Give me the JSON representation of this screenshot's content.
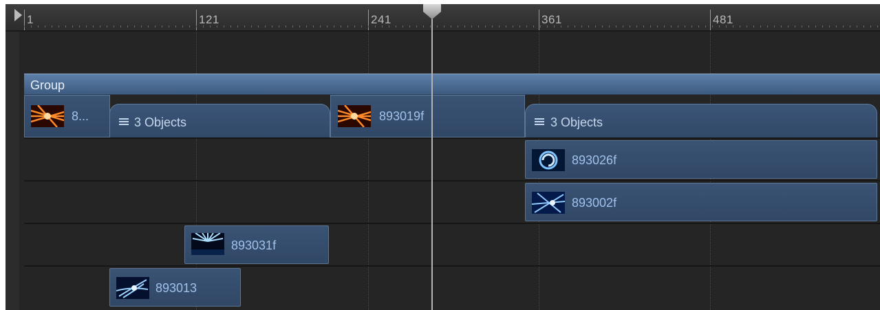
{
  "ruler": {
    "labels": [
      "1",
      "121",
      "241",
      "361",
      "481"
    ]
  },
  "group": {
    "label": "Group"
  },
  "clips": {
    "clip_a": "8...",
    "objects_a": "3 Objects",
    "clip_b": "893019f",
    "objects_b": "3 Objects",
    "clip_c": "893026f",
    "clip_d": "893002f",
    "clip_e": "893031f",
    "clip_f": "893013"
  },
  "icons": {
    "playhead": "playhead-marker-icon",
    "play_range": "play-range-start-icon",
    "objects": "list-icon"
  },
  "colors": {
    "background": "#252525",
    "group_bar": "#4c6d95",
    "layer": "#35506f",
    "clip_text": "#9fc1ea",
    "playhead": "#b4b4b4"
  }
}
